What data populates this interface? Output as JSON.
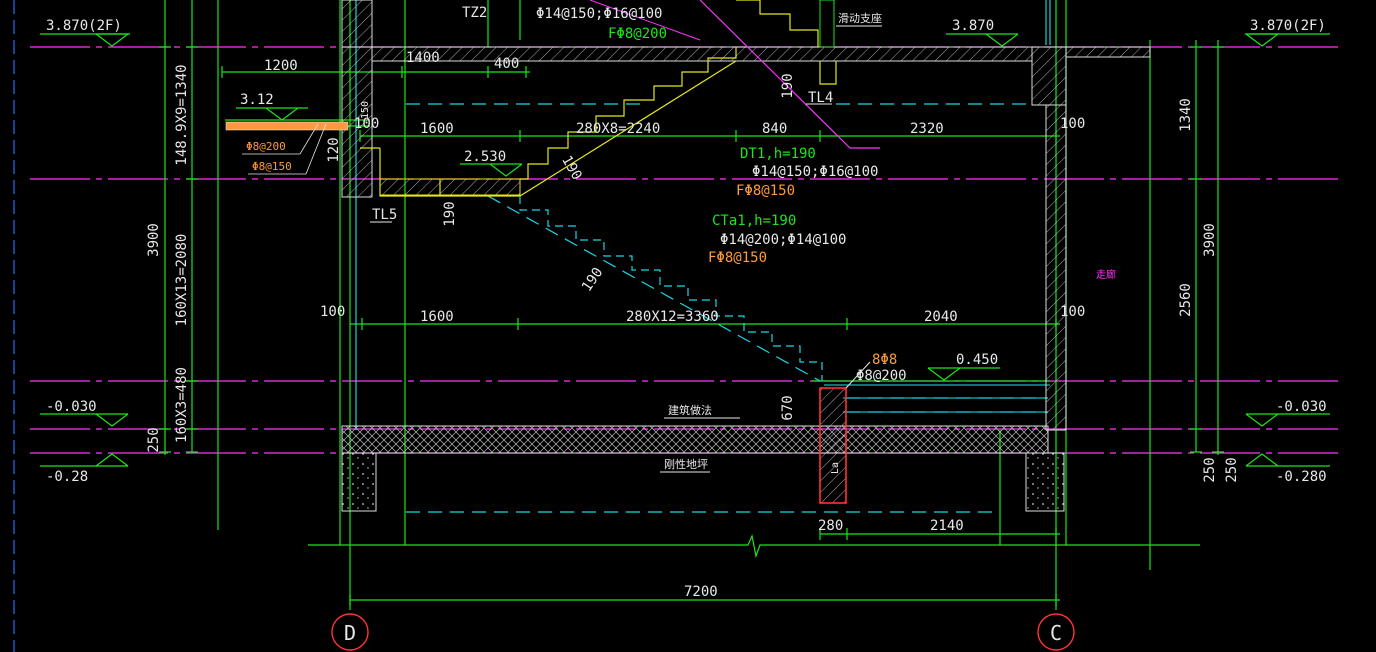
{
  "colors": {
    "background": "#000000",
    "dimension": "#19e619",
    "text": "#e8e8e8",
    "rebar_note": "#ff9a3c",
    "cyan": "#19e6e6",
    "magenta": "#ff33ff",
    "red": "#ff3333",
    "yellow": "#e6e619",
    "blue_dash": "#3c8cff"
  },
  "axes": {
    "left": "D",
    "right": "C"
  },
  "elevations": {
    "top_left": "3.870(2F)",
    "top_mid": "3.870",
    "top_right": "3.870(2F)",
    "left_platform": "3.12",
    "landing_upper": "2.530",
    "landing_lower": "0.450",
    "left_floor": "-0.030",
    "right_floor": "-0.030",
    "left_ground": "-0.28",
    "right_ground": "-0.280"
  },
  "dims": {
    "left_vert_1": "148.9X9=1340",
    "left_vert_2": "160X13=2080",
    "left_vert_3": "160X3=480",
    "left_total": "3900",
    "left_250": "250",
    "right_1340": "1340",
    "right_2560": "2560",
    "right_3900": "3900",
    "right_250a": "250",
    "right_250b": "250",
    "top_1400": "1400",
    "top_400": "400",
    "top_1200": "1200",
    "mid_100a": "100",
    "mid_1600a": "1600",
    "mid_stair_upper": "280X8=2240",
    "mid_840": "840",
    "mid_2320": "2320",
    "mid_100b": "100",
    "low_100a": "100",
    "low_1600": "1600",
    "low_stair": "280X12=3360",
    "low_2040": "2040",
    "low_100b": "100",
    "v_190a": "190",
    "v_190b": "190",
    "v_190c": "190",
    "v_190d": "190",
    "v_120": "120",
    "v_150": "150",
    "v_670": "670",
    "bot_280": "280",
    "bot_2140": "2140",
    "bot_7200": "7200"
  },
  "labels": {
    "tz2": "TZ2",
    "tl4": "TL4",
    "tl5": "TL5",
    "slide_support": "滑动支座",
    "arch_method": "建筑做法",
    "rigid_floor": "刚性地坪",
    "corridor": "走廊",
    "la": "La"
  },
  "rebar": {
    "top_main": "Φ14@150;Φ16@100",
    "top_dist": "FΦ8@200",
    "dt1_name": "DT1,h=190",
    "dt1_main": "Φ14@150;Φ16@100",
    "dt1_dist": "FΦ8@150",
    "cta1_name": "CTa1,h=190",
    "cta1_main": "Φ14@200;Φ14@100",
    "cta1_dist": "FΦ8@150",
    "plat_a": "Φ8@200",
    "plat_b": "Φ8@150",
    "beam_top": "8Φ8",
    "beam_stir": "Φ8@200"
  }
}
